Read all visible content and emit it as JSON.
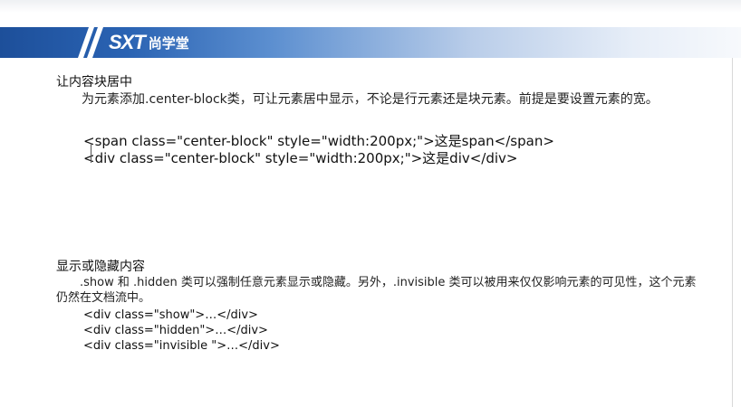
{
  "header": {
    "logo_mark": "SXT",
    "logo_text": "尚学堂",
    "colors": {
      "banner_dark": "#1d4f9a",
      "banner_light": "#e7eef8"
    }
  },
  "section1": {
    "title": "让内容块居中",
    "desc": "为元素添加.center-block类，可让元素居中显示，不论是行元素还是块元素。前提是要设置元素的宽。",
    "code": [
      "<span class=\"center-block\" style=\"width:200px;\">这是span</span>",
      "<div class=\"center-block\" style=\"width:200px;\">这是div</div>"
    ]
  },
  "section2": {
    "title": "显示或隐藏内容",
    "desc": ".show 和 .hidden 类可以强制任意元素显示或隐藏。另外，.invisible 类可以被用来仅仅影响元素的可见性，这个元素仍然在文档流中。",
    "code": [
      "<div class=\"show\">…</div>",
      "<div class=\"hidden\">…</div>",
      "<div class=\"invisible \">…</div>"
    ]
  }
}
